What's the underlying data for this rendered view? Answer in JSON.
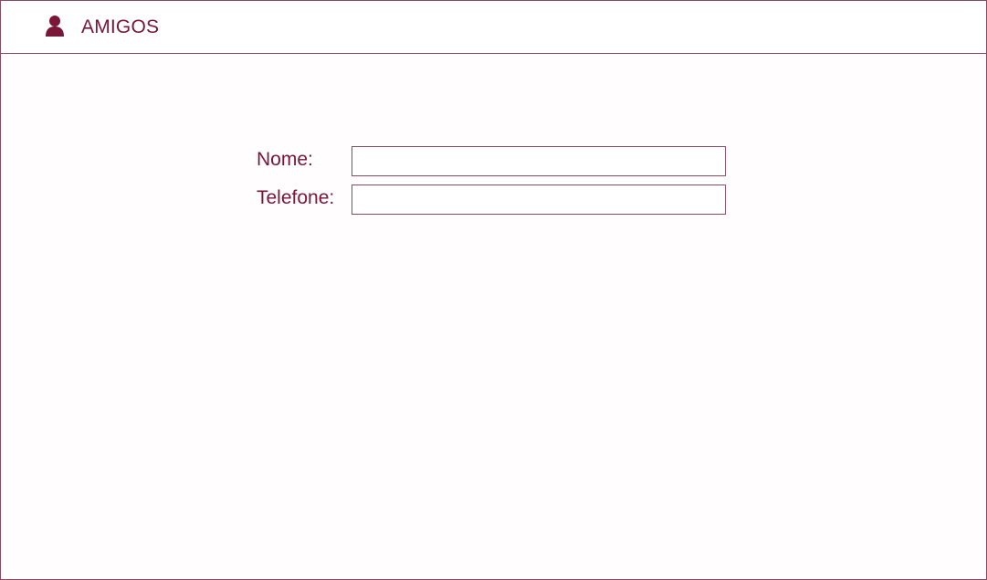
{
  "header": {
    "icon": "user-icon",
    "title": "AMIGOS"
  },
  "form": {
    "fields": [
      {
        "label": "Nome:",
        "value": "",
        "placeholder": ""
      },
      {
        "label": "Telefone:",
        "value": "",
        "placeholder": ""
      }
    ]
  },
  "colors": {
    "accent": "#7a1638",
    "border": "#8a4a63",
    "background": "#fffdfd"
  }
}
